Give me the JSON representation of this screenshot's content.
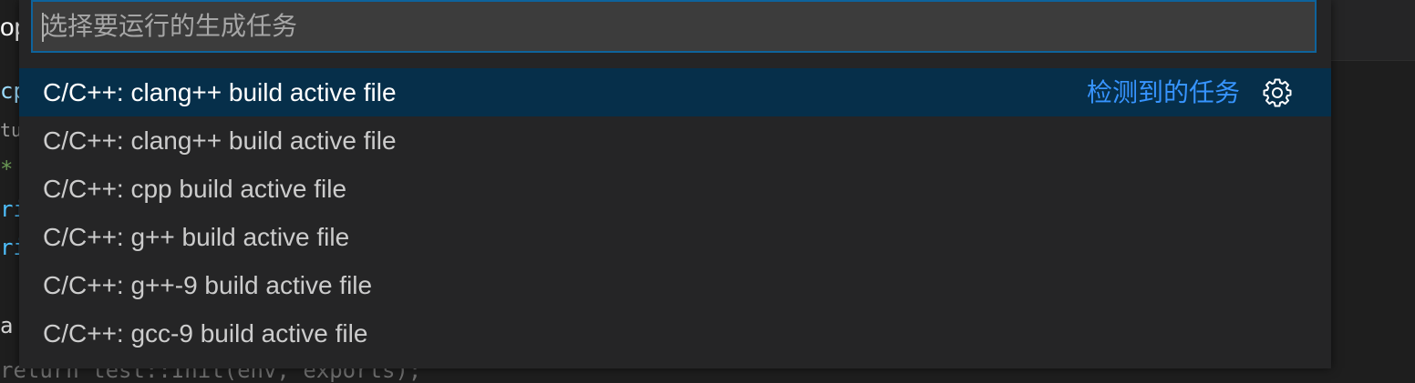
{
  "quick_pick": {
    "placeholder": "选择要运行的生成任务",
    "value": "",
    "items": [
      {
        "label": "C/C++: clang++ build active file",
        "description": "检测到的任务",
        "focused": true
      },
      {
        "label": "C/C++: clang++ build active file"
      },
      {
        "label": "C/C++: cpp build active file"
      },
      {
        "label": "C/C++: g++ build active file"
      },
      {
        "label": "C/C++: g++-9 build active file"
      },
      {
        "label": "C/C++: gcc-9 build active file"
      }
    ],
    "configure_icon": "gear-icon"
  },
  "editor_fragments": {
    "tab_text": "op",
    "line1": "cp",
    "line2": "tu",
    "line3": "*",
    "line4": "ri",
    "line5": "ri",
    "line6": "a",
    "line7": "return test::Init(env, exports);"
  },
  "colors": {
    "list_focus_bg": "#062f4a",
    "input_border": "#0e639c",
    "description": "#3794ff",
    "widget_bg": "#252526",
    "editor_bg": "#1e1e1e"
  }
}
